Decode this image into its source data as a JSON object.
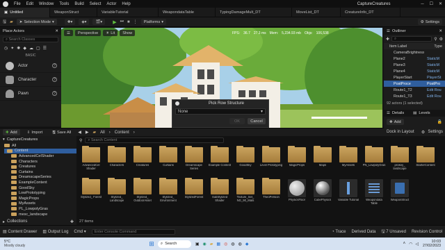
{
  "menu": [
    "File",
    "Edit",
    "Window",
    "Tools",
    "Build",
    "Select",
    "Actor",
    "Help"
  ],
  "tabs": [
    "Untitled",
    "WeaponStruct",
    "VariableTutorial",
    "WeapondataTable",
    "TypingDamageMult_DT",
    "MoveList_DT",
    "CreatureInfo_DT"
  ],
  "project_title": "CaptureCreatures",
  "toolbar": {
    "save_label": "",
    "mode": "Selection Mode",
    "platforms": "Platforms",
    "settings": "Settings"
  },
  "stats": {
    "fps": "36.7",
    "ms": "27.3 ms",
    "mem": "5,234.93 mb",
    "objs": "106,538"
  },
  "place_actors": {
    "title": "Place Actors",
    "search_placeholder": "Search Classes",
    "basic": "BASIC",
    "items": [
      "Actor",
      "Character",
      "Pawn"
    ]
  },
  "viewport": {
    "perspective": "Perspective",
    "lit": "Lit",
    "show": "Show"
  },
  "outliner": {
    "title": "Outliner",
    "label_col": "Item Label",
    "type_col": "Type",
    "rows": [
      {
        "name": "CameraBrightnessPerso",
        "type": ""
      },
      {
        "name": "Plane2",
        "type": "StaticM"
      },
      {
        "name": "Plane3",
        "type": "StaticM"
      },
      {
        "name": "Plane4",
        "type": "StaticM"
      },
      {
        "name": "PlayerStart",
        "type": "PlayerSt"
      },
      {
        "name": "PostProce",
        "type": "PostPro"
      },
      {
        "name": "Route1_T2",
        "type": "Edit Rou"
      },
      {
        "name": "Route1_T3",
        "type": "Edit Rou"
      }
    ],
    "count": "92 actors (1 selected)"
  },
  "details": {
    "title": "Details",
    "levels": "Levels",
    "add": "Add",
    "dock": "Dock in Layout",
    "settings": "Settings"
  },
  "dialog": {
    "title": "Pick Row Structure",
    "value": "None",
    "ok": "OK",
    "cancel": "Cancel"
  },
  "cb": {
    "add": "Add",
    "import": "Import",
    "save_all": "Save All",
    "path_all": "All",
    "path_content": "Content",
    "search_placeholder": "Search Content",
    "tree_title": "CaptureCreatures",
    "tree": [
      "All",
      "Content",
      "AdvancedCelShader",
      "Characters",
      "Creatures",
      "Curtains",
      "DreamscapeSeries",
      "ExampleContent",
      "GoodSky",
      "LowPrototyping",
      "MagicProps",
      "MyAssets",
      "PL_LowpolyGras",
      "mesc_landscape"
    ],
    "row1": [
      "AdvancedCel Shader",
      "Characters",
      "Creatures",
      "Curtains",
      "Dreamscape Series",
      "Example Content",
      "GoodSky",
      "Level Prototyping",
      "MagicProps",
      "Maps",
      "MyAssets",
      "PN_LowpolyGras",
      "prokey_ landscape",
      "StarterContent"
    ],
    "row2": [
      "Stylized_ Forest",
      "Stylized_ Landscape",
      "Stylized_ OutdoorAsset",
      "Stylized_ Environment",
      "StylizedForest",
      "SubStylized Shader",
      "Texture_Set_ NG_90_Mats",
      "TheoPersion",
      "PhysicsFloor",
      "CubePhysics",
      "Variable Tutorial",
      "Weapondata Table",
      "WeaponStruct"
    ],
    "items": "27 items",
    "collections": "Collections"
  },
  "status": {
    "content_drawer": "Content Drawer",
    "output_log": "Output Log",
    "cmd": "Cmd",
    "console": "Enter Console Command",
    "trace": "Trace",
    "derived": "Derived Data",
    "unsaved": "7 Unsaved",
    "revision": "Revision Control"
  },
  "taskbar": {
    "temp": "5°C",
    "weather": "Mostly cloudy",
    "search": "Search",
    "time": "10:03",
    "date": "27/02/2023"
  },
  "colors": {
    "accent": "#2f5e9e",
    "folder": "#c9a35e",
    "sky": "#a8d0e8",
    "play": "#5fbf3f"
  }
}
